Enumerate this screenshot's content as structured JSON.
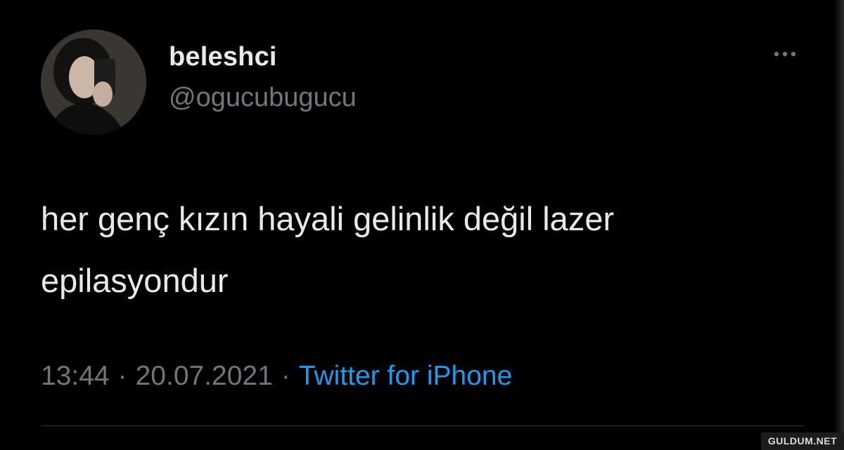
{
  "author": {
    "display_name": "beleshci",
    "handle": "@ogucubugucu",
    "avatar_icon": "profile-photo"
  },
  "tweet": {
    "text": "her genç kızın hayali gelinlik değil lazer epilasyondur",
    "time": "13:44",
    "separator": "·",
    "date": "20.07.2021",
    "source": "Twitter for iPhone"
  },
  "actions": {
    "more_icon": "more-horizontal-icon"
  },
  "colors": {
    "background": "#000000",
    "primary_text": "#e7e9ea",
    "secondary_text": "#71767b",
    "link": "#1d9bf0",
    "divider": "#2f3336"
  },
  "watermark": {
    "text": "GULDUM.NET"
  }
}
